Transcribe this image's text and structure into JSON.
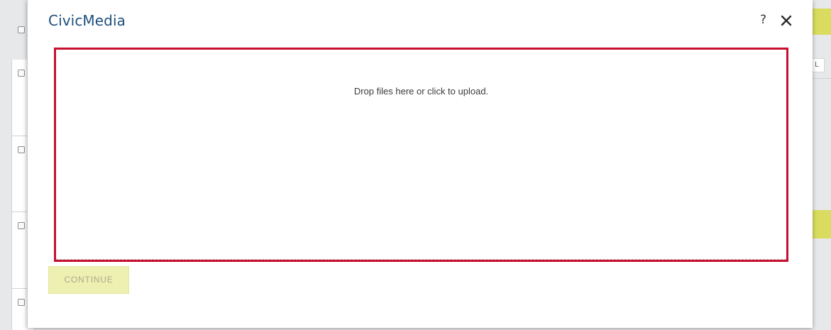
{
  "modal": {
    "title": "CivicMedia",
    "help_label": "?",
    "dropzone_text": "Drop files here or click to upload.",
    "continue_label": "CONTINUE"
  },
  "background": {
    "right_chip_text": "L"
  },
  "colors": {
    "title": "#1e4f7d",
    "dropzone_border": "#c8102e",
    "continue_bg": "#eef0b2",
    "accent_yellow": "#d9dc5f"
  },
  "icons": {
    "help": "help-icon",
    "close": "close-icon"
  }
}
